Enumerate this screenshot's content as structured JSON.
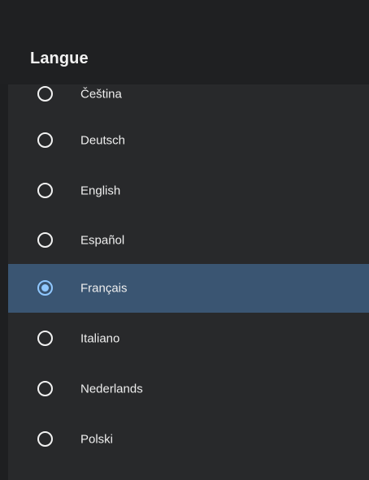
{
  "dialog": {
    "title": "Langue"
  },
  "languages": [
    {
      "label": "Čeština",
      "selected": false
    },
    {
      "label": "Deutsch",
      "selected": false
    },
    {
      "label": "English",
      "selected": false
    },
    {
      "label": "Español",
      "selected": false
    },
    {
      "label": "Français",
      "selected": true
    },
    {
      "label": "Italiano",
      "selected": false
    },
    {
      "label": "Nederlands",
      "selected": false
    },
    {
      "label": "Polski",
      "selected": false
    }
  ],
  "colors": {
    "background": "#1e1f21",
    "list_background": "#28292b",
    "selected_row": "#3a5572",
    "accent": "#90c8ff",
    "text": "#eeeeee"
  }
}
